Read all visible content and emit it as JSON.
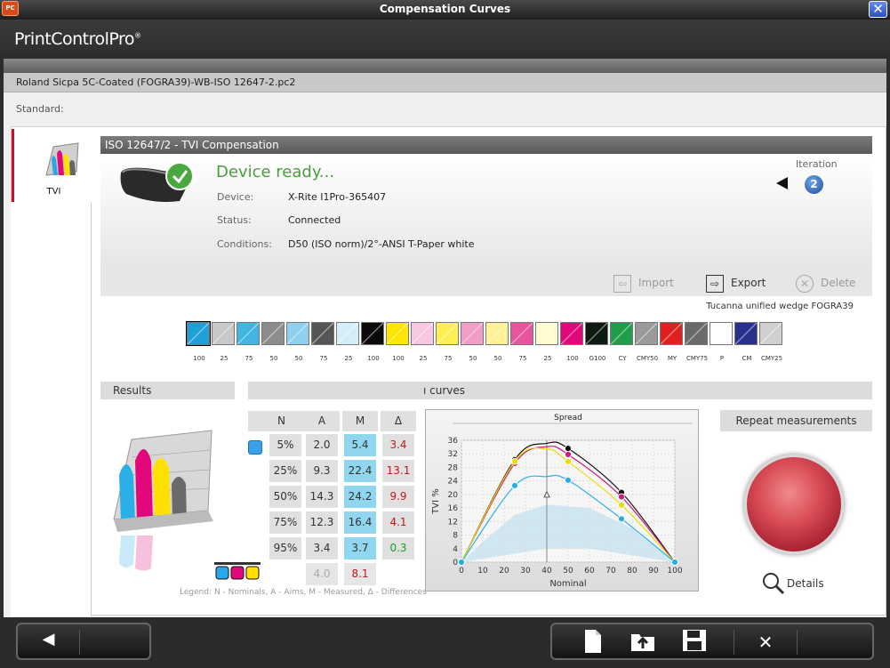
{
  "window": {
    "title": "Compensation Curves",
    "app_icon": "PC"
  },
  "logo": {
    "text": "PrintControlPro",
    "reg": "®"
  },
  "profile": {
    "name": "Roland Sicpa 5C-Coated (FOGRA39)-WB-ISO 12647-2.pc2"
  },
  "standard": {
    "label": "Standard:"
  },
  "sidebar": {
    "tab_label": "TVI"
  },
  "section": {
    "title": "ISO 12647/2 - TVI Compensation"
  },
  "device": {
    "status_title": "Device ready...",
    "rows": [
      {
        "k": "Device:",
        "v": "X-Rite I1Pro-365407"
      },
      {
        "k": "Status:",
        "v": "Connected"
      },
      {
        "k": "Conditions:",
        "v": "D50 (ISO norm)/2°-ANSI T-Paper white"
      }
    ]
  },
  "iteration": {
    "label": "Iteration",
    "value": "2"
  },
  "toolbar": {
    "import": "Import",
    "export": "Export",
    "delete": "Delete"
  },
  "wedge": {
    "name": "Tucanna unified wedge FOGRA39",
    "swatches": [
      {
        "c": "#1fa0d6",
        "l": "100",
        "sel": true
      },
      {
        "c": "#c8c8c8",
        "l": "25"
      },
      {
        "c": "#3fb5e0",
        "l": "75"
      },
      {
        "c": "#8c8c8c",
        "l": "50"
      },
      {
        "c": "#8fd0ee",
        "l": "50"
      },
      {
        "c": "#555555",
        "l": "75"
      },
      {
        "c": "#d4eef8",
        "l": "25"
      },
      {
        "c": "#0a0a0a",
        "l": "100"
      },
      {
        "c": "#ffe600",
        "l": "100"
      },
      {
        "c": "#f9c8e0",
        "l": "25"
      },
      {
        "c": "#ffee50",
        "l": "75"
      },
      {
        "c": "#f29cc8",
        "l": "50"
      },
      {
        "c": "#fff196",
        "l": "50"
      },
      {
        "c": "#e8559d",
        "l": "75"
      },
      {
        "c": "#fffad0",
        "l": "25"
      },
      {
        "c": "#e2087c",
        "l": "100"
      },
      {
        "c": "#0d1a12",
        "l": "G100"
      },
      {
        "c": "#1e9e48",
        "l": "CY"
      },
      {
        "c": "#9a9a9a",
        "l": "CMY50"
      },
      {
        "c": "#e02020",
        "l": "MY"
      },
      {
        "c": "#6a6a6a",
        "l": "CMY75"
      },
      {
        "c": "#ffffff",
        "l": "P"
      },
      {
        "c": "#2a2f8c",
        "l": "CM"
      },
      {
        "c": "#d0d0d0",
        "l": "CMY25"
      }
    ]
  },
  "results": {
    "title": "Results"
  },
  "curves": {
    "title": "ı curves"
  },
  "table": {
    "headers": [
      "N",
      "A",
      "M",
      "Δ"
    ],
    "rows": [
      {
        "n": "5%",
        "a": "2.0",
        "m": "5.4",
        "d": "3.4",
        "dc": "#c01818"
      },
      {
        "n": "25%",
        "a": "9.3",
        "m": "22.4",
        "d": "13.1",
        "dc": "#c01818"
      },
      {
        "n": "50%",
        "a": "14.3",
        "m": "24.2",
        "d": "9.9",
        "dc": "#c01818"
      },
      {
        "n": "75%",
        "a": "12.3",
        "m": "16.4",
        "d": "4.1",
        "dc": "#c01818"
      },
      {
        "n": "95%",
        "a": "3.4",
        "m": "3.7",
        "d": "0.3",
        "dc": "#1a9e2a"
      }
    ],
    "summary": {
      "a": "4.0",
      "m": "8.1"
    },
    "legend": "Legend: N - Nominals, A - Aims, M - Measured, Δ - Differences"
  },
  "chart_data": {
    "type": "line",
    "title": "Spread",
    "xlabel": "Nominal",
    "ylabel": "TVI %",
    "xlim": [
      0,
      100
    ],
    "ylim": [
      0,
      36
    ],
    "xticks": [
      0,
      10,
      20,
      30,
      40,
      50,
      60,
      70,
      80,
      90,
      100
    ],
    "yticks": [
      0,
      4,
      8,
      12,
      16,
      20,
      24,
      28,
      32,
      36
    ],
    "aim_marker_x": 40,
    "series": [
      {
        "color": "#111111",
        "x": [
          0,
          25,
          40,
          50,
          75,
          100
        ],
        "values": [
          0,
          30.3,
          35.1,
          33.6,
          20.6,
          0
        ]
      },
      {
        "color": "#cc1a7a",
        "x": [
          0,
          25,
          40,
          50,
          75,
          100
        ],
        "values": [
          0,
          29.2,
          34.1,
          31.8,
          19.3,
          0
        ]
      },
      {
        "color": "#e8de00",
        "x": [
          0,
          25,
          40,
          50,
          75,
          100
        ],
        "values": [
          0,
          29.8,
          33.4,
          29.7,
          16.9,
          0
        ]
      },
      {
        "color": "#2ab0e0",
        "x": [
          0,
          25,
          40,
          50,
          75,
          100
        ],
        "values": [
          0,
          22.6,
          25.3,
          24.2,
          12.8,
          0
        ]
      }
    ]
  },
  "repeat": {
    "title": "Repeat measurements",
    "details": "Details"
  },
  "colors": {
    "accent_red": "#c8102e",
    "green": "#4a9e3c",
    "cyan_cell": "#8fd6ee"
  }
}
